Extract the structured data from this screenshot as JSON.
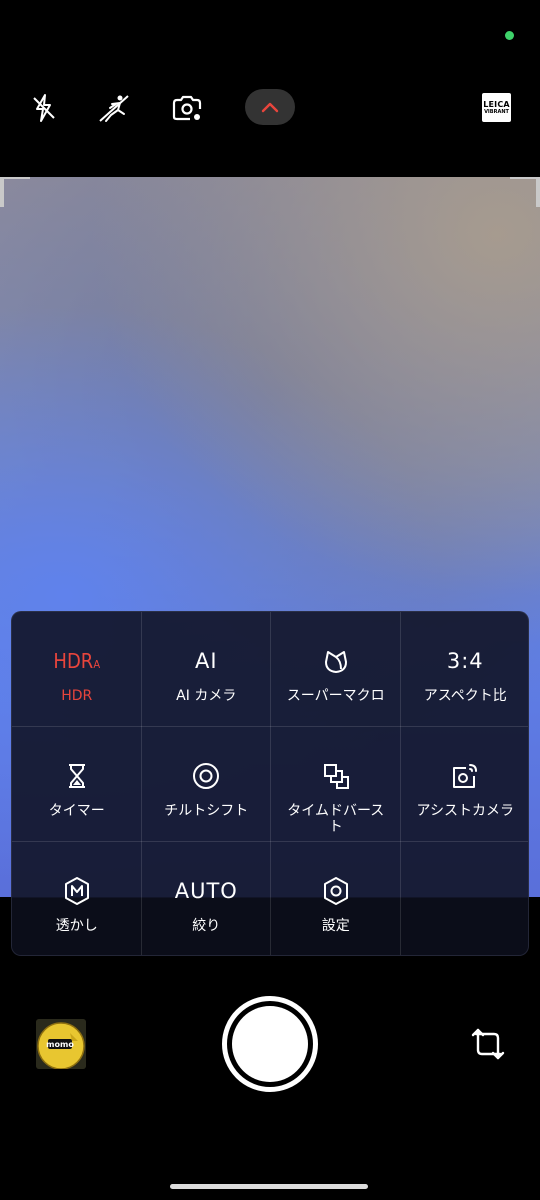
{
  "status": {
    "indicator_color": "#3ed26a"
  },
  "top_bar": {
    "icons": [
      "flash-off-icon",
      "motion-off-icon",
      "smart-capture-icon",
      "expand-chevron-icon"
    ],
    "leica": {
      "line1": "LEICA",
      "line2": "VIBRANT"
    }
  },
  "quick_panel": {
    "accent_color": "#e8453c",
    "items": [
      {
        "icon_text": "HDR",
        "icon_sub": "A",
        "label": "HDR",
        "active": true
      },
      {
        "icon_text": "AI",
        "label": "AI カメラ"
      },
      {
        "icon": "super-macro-icon",
        "label": "スーパーマクロ"
      },
      {
        "icon_text": "3:4",
        "label": "アスペクト比"
      },
      {
        "icon": "timer-icon",
        "label": "タイマー"
      },
      {
        "icon": "tilt-shift-icon",
        "label": "チルトシフト"
      },
      {
        "icon": "timed-burst-icon",
        "label": "タイムドバースト"
      },
      {
        "icon": "assist-camera-icon",
        "label": "アシストカメラ"
      },
      {
        "icon": "watermark-icon",
        "label": "透かし"
      },
      {
        "icon_text": "AUTO",
        "label": "絞り"
      },
      {
        "icon": "settings-icon",
        "label": "設定"
      }
    ]
  },
  "bottom_bar": {
    "thumbnail_text": "momo",
    "switch_icon": "switch-camera-icon"
  }
}
